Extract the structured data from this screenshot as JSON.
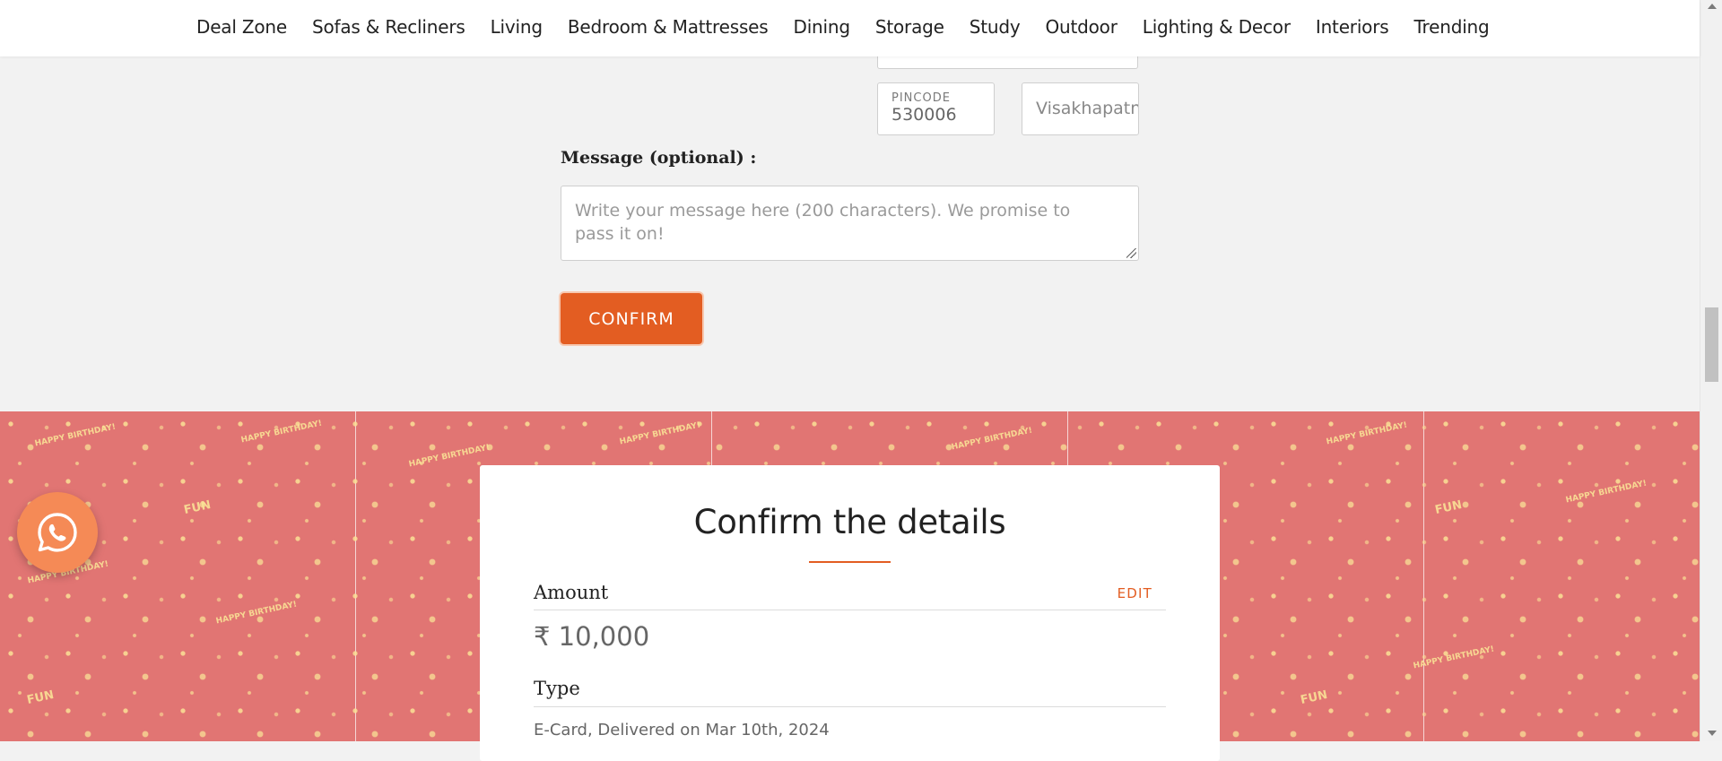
{
  "nav": {
    "items": [
      "Deal Zone",
      "Sofas & Recliners",
      "Living",
      "Bedroom & Mattresses",
      "Dining",
      "Storage",
      "Study",
      "Outdoor",
      "Lighting & Decor",
      "Interiors",
      "Trending"
    ]
  },
  "form": {
    "pincode_label": "PINCODE",
    "pincode_value": "530006",
    "city_value": "Visakhapatnam",
    "message_label": "Message (optional) :",
    "message_placeholder": "Write your message here (200 characters). We promise to pass it on!",
    "confirm_label": "CONFIRM"
  },
  "pattern": {
    "tags": [
      "HAPPY BIRTHDAY!",
      "FUN"
    ]
  },
  "card": {
    "title": "Confirm the details",
    "amount_label": "Amount",
    "edit_label": "EDIT",
    "amount_value": "₹ 10,000",
    "type_label": "Type",
    "type_value": "E-Card, Delivered on Mar 10th, 2024"
  },
  "colors": {
    "accent": "#e35d22",
    "pattern_bg": "#e17573",
    "whatsapp_bg": "#f58a56"
  },
  "icons": {
    "whatsapp": "whatsapp-icon"
  }
}
